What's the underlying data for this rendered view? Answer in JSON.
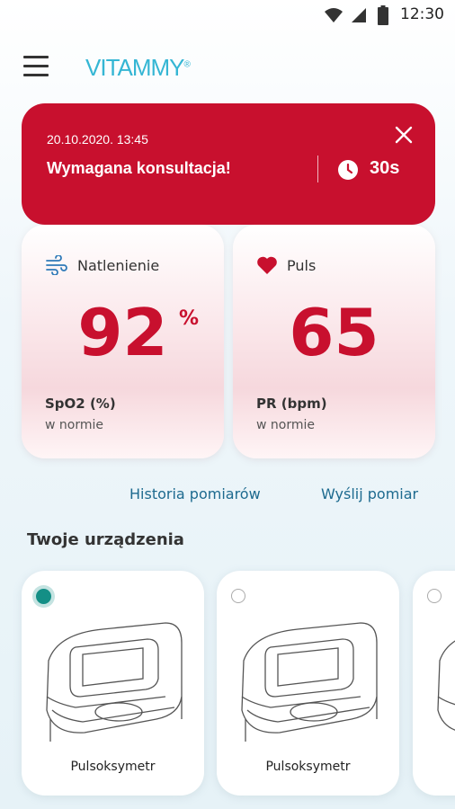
{
  "status_bar": {
    "time": "12:30",
    "icons": [
      "wifi-icon",
      "cellular-signal-icon",
      "battery-icon"
    ]
  },
  "app_bar": {
    "logo_text": "VITAMMY",
    "logo_mark": "®"
  },
  "alert": {
    "date": "20.10.2020.  13:45",
    "message": "Wymagana konsultacja!",
    "timer": "30s",
    "color": "#c8102e"
  },
  "metrics": {
    "oxygen": {
      "title": "Natlenienie",
      "value": "92",
      "unit": "%",
      "label": "SpO2 (%)",
      "status": "w normie"
    },
    "pulse": {
      "title": "Puls",
      "value": "65",
      "label": "PR (bpm)",
      "status": "w normie"
    }
  },
  "links": {
    "history": "Historia pomiarów",
    "send": "Wyślij pomiar"
  },
  "devices": {
    "title": "Twoje urządzenia",
    "items": [
      {
        "name": "Pulsoksymetr",
        "selected": true
      },
      {
        "name": "Pulsoksymetr",
        "selected": false
      },
      {
        "name": "",
        "selected": false
      }
    ]
  },
  "colors": {
    "accent_red": "#c8102e",
    "link_blue": "#1d6a8f",
    "selected_teal": "#148f86",
    "logo_blue": "#35b6d4"
  }
}
